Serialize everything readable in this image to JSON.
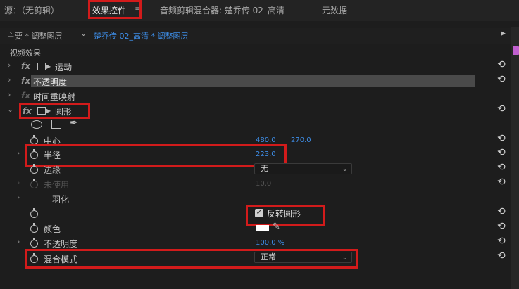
{
  "top_tabs": {
    "source": "源：（无剪辑）",
    "effect_controls": "效果控件",
    "menu_glyph": "≡",
    "audio_mixer": "音频剪辑混合器: 楚乔传 02_高清",
    "metadata": "元数据"
  },
  "sequence_bar": {
    "master": "主要 * 调整图层",
    "chevron": "⌄",
    "sequence": "楚乔传 02_高清 * 调整图层",
    "play": "▶"
  },
  "section_title": "视频效果",
  "effects": [
    {
      "name": "运动"
    },
    {
      "name": "不透明度"
    },
    {
      "name": "时间重映射"
    },
    {
      "name": "圆形"
    }
  ],
  "fx_label": "fx",
  "circle_params": {
    "center_label": "中心",
    "center_x": "480.0",
    "center_y": "270.0",
    "radius_label": "半径",
    "radius_value": "223.0",
    "edge_label": "边缘",
    "edge_value": "无",
    "unused_label": "未使用",
    "unused_value": "10.0",
    "feather_label": "羽化",
    "invert_label": "反转圆形",
    "invert_checked": true,
    "color_label": "颜色",
    "opacity_label": "不透明度",
    "opacity_value": "100.0 %",
    "blend_label": "混合模式",
    "blend_value": "正常"
  },
  "glyphs": {
    "reset": "⟲",
    "chev_right": "›",
    "chev_down": "⌄",
    "dd_arrow": "⌄",
    "check": "✓",
    "pen": "✒",
    "eyedropper": "✎"
  },
  "colors": {
    "highlight_red": "#d21b1b",
    "value_blue": "#3e8ee8",
    "swatch": "#ffffff"
  }
}
